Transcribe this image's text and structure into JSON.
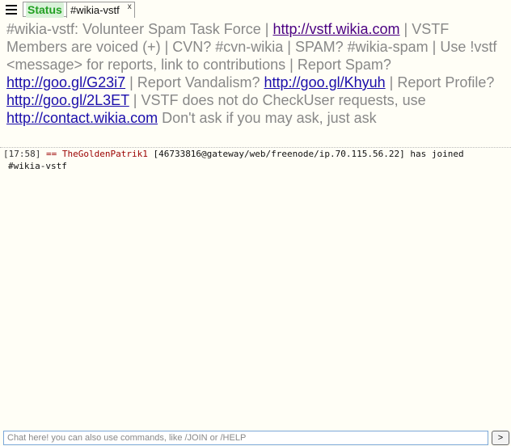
{
  "tabbar": {
    "status_label": "Status",
    "channel_label": "#wikia-vstf",
    "close_label": "x"
  },
  "topic": {
    "t1": "#wikia-vstf: Volunteer Spam Task Force | ",
    "link1": "http://vstf.wikia.com",
    "t2": " | VSTF Members are voiced (+) | CVN? #cvn-wikia | SPAM? #wikia-spam | Use !vstf <message> for reports, link to contributions | Report Spam? ",
    "link2": "http://goo.gl/G23i7",
    "t3": " | Report Vandalism? ",
    "link3": "http://goo.gl/Khyuh",
    "t4": " | Report Profile? ",
    "link4": "http://goo.gl/2L3ET",
    "t5": " | VSTF does not do CheckUser requests, use ",
    "link5": "http://contact.wikia.com",
    "t6": " Don't ask if you may ask, just ask"
  },
  "messages": [
    {
      "time": "[17:58]",
      "arrow": "==",
      "nick": "TheGoldenPatrik1",
      "host": "[46733816@gateway/web/freenode/ip.70.115.56.22]",
      "action": "has joined",
      "channel": "#wikia-vstf"
    }
  ],
  "input": {
    "placeholder": "Chat here! you can also use commands, like /JOIN or /HELP",
    "value": "",
    "send_label": ">"
  },
  "colors": {
    "background": "#fffef6",
    "status_green": "#22a022",
    "link": "#1a0dab",
    "visited_link": "#4b0082",
    "join_red": "#9b0000"
  },
  "icons": {
    "menu": "hamburger-menu-icon"
  }
}
